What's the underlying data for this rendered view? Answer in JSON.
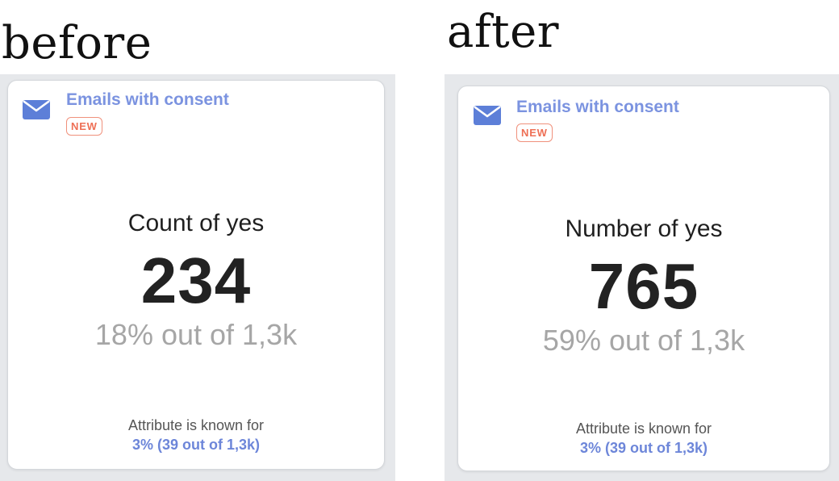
{
  "headings": {
    "before": "before",
    "after": "after"
  },
  "colors": {
    "accent": "#7b93e0",
    "badge": "#ee6f55",
    "panel_bg": "#e6e8eb",
    "muted_text": "#a6a6a6"
  },
  "before": {
    "icon": "envelope-icon",
    "title": "Emails with consent",
    "badge": "NEW",
    "metric_label": "Count of yes",
    "metric_value": "234",
    "metric_share": "18% out of 1,3k",
    "known_label": "Attribute is known for",
    "known_value": "3% (39 out of 1,3k)"
  },
  "after": {
    "icon": "envelope-icon",
    "title": "Emails with consent",
    "badge": "NEW",
    "metric_label": "Number of yes",
    "metric_value": "765",
    "metric_share": "59% out of 1,3k",
    "known_label": "Attribute is known for",
    "known_value": "3% (39 out of 1,3k)"
  }
}
